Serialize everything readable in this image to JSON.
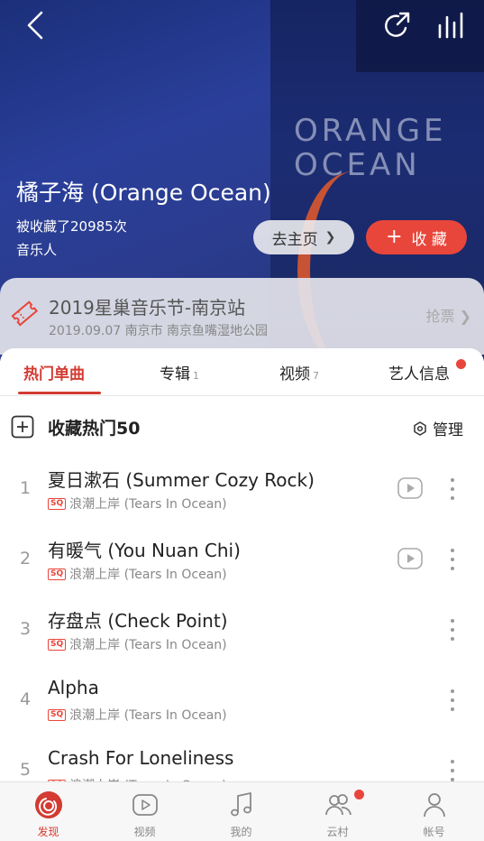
{
  "header": {
    "bg_logo_line1": "ORANGE",
    "bg_logo_line2": "OCEAN"
  },
  "artist": {
    "name": "橘子海 (Orange Ocean)",
    "favorited": "被收藏了20985次",
    "role": "音乐人"
  },
  "actions": {
    "home_label": "去主页",
    "home_chevron": "❯",
    "favorite_plus": "+",
    "favorite_label": "收 藏"
  },
  "event": {
    "title": "2019星巢音乐节-南京站",
    "subtitle": "2019.09.07 南京市 南京鱼嘴湿地公园",
    "cta": "抢票 ❯"
  },
  "tabs": [
    {
      "label": "热门单曲",
      "count": ""
    },
    {
      "label": "专辑",
      "count": "1"
    },
    {
      "label": "视频",
      "count": "7"
    },
    {
      "label": "艺人信息",
      "count": ""
    }
  ],
  "collect": {
    "label": "收藏热门50",
    "manage": "管理"
  },
  "badge_label": "SQ",
  "songs": [
    {
      "index": "1",
      "title": "夏日漱石 (Summer Cozy Rock)",
      "album": "浪潮上岸 (Tears In Ocean)"
    },
    {
      "index": "2",
      "title": "有暖气 (You Nuan Chi)",
      "album": "浪潮上岸 (Tears In Ocean)"
    },
    {
      "index": "3",
      "title": "存盘点 (Check Point)",
      "album": "浪潮上岸 (Tears In Ocean)"
    },
    {
      "index": "4",
      "title": "Alpha",
      "album": "浪潮上岸 (Tears In Ocean)"
    },
    {
      "index": "5",
      "title": "Crash For Loneliness",
      "album": "浪潮上岸 (Tears In Ocean)"
    }
  ],
  "nav": [
    {
      "label": "发现",
      "icon": "discover-icon"
    },
    {
      "label": "视频",
      "icon": "video-icon"
    },
    {
      "label": "我的",
      "icon": "music-note-icon"
    },
    {
      "label": "云村",
      "icon": "friends-icon"
    },
    {
      "label": "帐号",
      "icon": "account-icon"
    }
  ],
  "colors": {
    "accent": "#d33a31",
    "favorite_button": "#e8463b",
    "hero_bg": "#2a3f9a"
  }
}
